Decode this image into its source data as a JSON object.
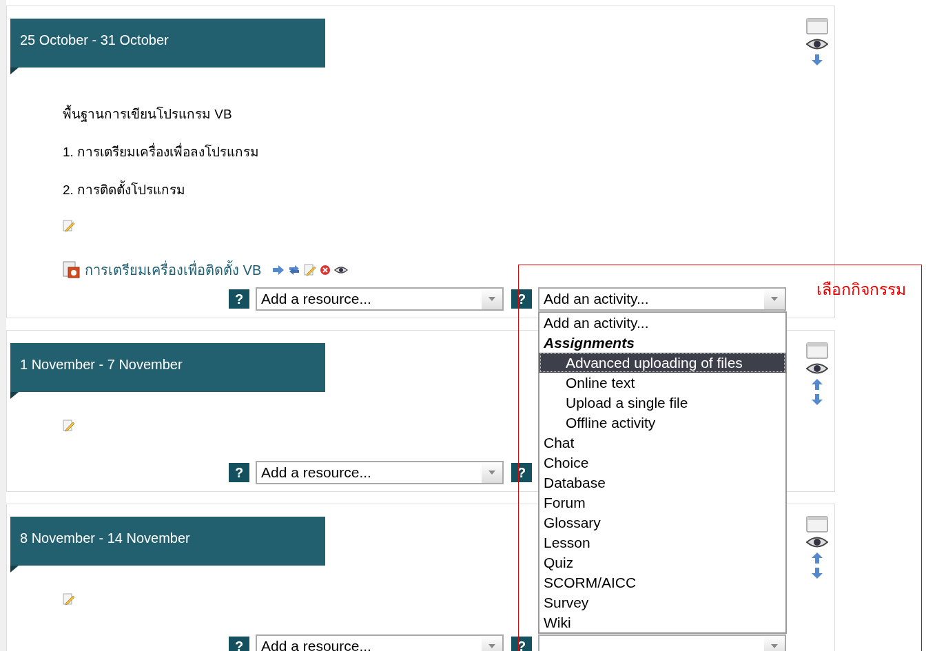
{
  "sections": [
    {
      "title": "25 October - 31 October",
      "summary": [
        "พื้นฐานการเขียนโปรแกรม VB",
        "1. การเตรียมเครื่องเพื่อลงโปรแกรม",
        "2. การติดตั้งโปรแกรม"
      ],
      "resources": [
        {
          "label": "การเตรียมเครื่องเพื่อติดตั้ง VB"
        }
      ],
      "resource_help": "?",
      "resource_select": {
        "value": "Add a resource..."
      },
      "activity_help": "?",
      "activity_select": {
        "value": "Add an activity..."
      },
      "can_move_up": false,
      "can_move_down": true
    },
    {
      "title": "1 November - 7 November",
      "resource_help": "?",
      "resource_select": {
        "value": "Add a resource..."
      },
      "activity_help": "?",
      "can_move_up": true,
      "can_move_down": true
    },
    {
      "title": "8 November - 14 November",
      "resource_help": "?",
      "resource_select": {
        "value": "Add a resource..."
      },
      "activity_help": "?",
      "can_move_up": true,
      "can_move_down": true
    }
  ],
  "activity_menu": {
    "items": [
      {
        "kind": "option",
        "label": "Add an activity...",
        "selected": false
      },
      {
        "kind": "group",
        "label": "Assignments",
        "selected": false
      },
      {
        "kind": "suboption",
        "label": "Advanced uploading of files",
        "selected": true
      },
      {
        "kind": "suboption",
        "label": "Online text",
        "selected": false
      },
      {
        "kind": "suboption",
        "label": "Upload a single file",
        "selected": false
      },
      {
        "kind": "suboption",
        "label": "Offline activity",
        "selected": false
      },
      {
        "kind": "option",
        "label": "Chat",
        "selected": false
      },
      {
        "kind": "option",
        "label": "Choice",
        "selected": false
      },
      {
        "kind": "option",
        "label": "Database",
        "selected": false
      },
      {
        "kind": "option",
        "label": "Forum",
        "selected": false
      },
      {
        "kind": "option",
        "label": "Glossary",
        "selected": false
      },
      {
        "kind": "option",
        "label": "Lesson",
        "selected": false
      },
      {
        "kind": "option",
        "label": "Quiz",
        "selected": false
      },
      {
        "kind": "option",
        "label": "SCORM/AICC",
        "selected": false
      },
      {
        "kind": "option",
        "label": "Survey",
        "selected": false
      },
      {
        "kind": "option",
        "label": "Wiki",
        "selected": false
      }
    ]
  },
  "annotation": {
    "label": "เลือกกิจกรรม"
  }
}
